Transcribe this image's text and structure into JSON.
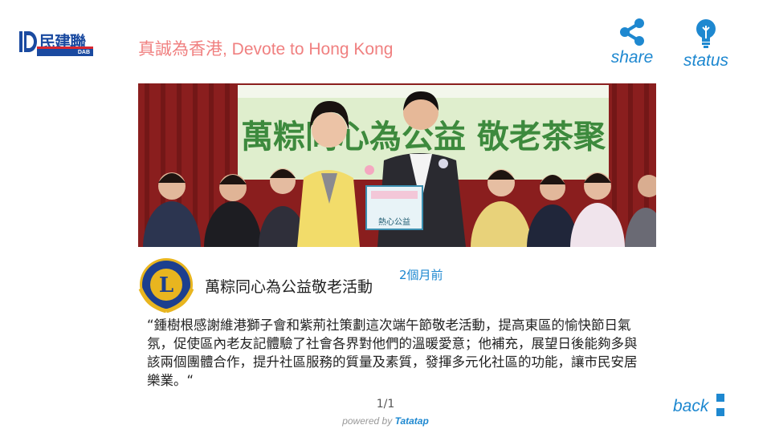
{
  "brand": {
    "logo_zh": "民建聯",
    "logo_en": "DAB",
    "tagline": "真誠為香港, Devote to Hong Kong"
  },
  "controls": {
    "share_label": "share",
    "status_label": "status",
    "back_label": "back",
    "icons": [
      "share-icon",
      "lightbulb-icon",
      "back-icon"
    ]
  },
  "photo": {
    "banner_text": "萬粽同心為公益 敬老茶聚",
    "certificate_text": "熱心公益"
  },
  "post": {
    "title": "萬粽同心為公益敬老活動",
    "time": "2個月前",
    "body": "“鍾樹根感謝維港獅子會和紫荊社策劃這次端午節敬老活動，提高東區的愉快節日氣氛，促使區內老友記體驗了社會各界對他們的溫暖愛意；他補充，展望日後能夠多與該兩個團體合作，提升社區服務的質量及素質，發揮多元化社區的功能，讓市民安居樂業。“"
  },
  "footer": {
    "pager": "1/1",
    "powered_prefix": "powered by ",
    "powered_brand": "Tatatap"
  },
  "colors": {
    "accent": "#1e88d0",
    "tagline": "#f08080",
    "logo_blue": "#1a4aa0",
    "logo_red": "#d8262f"
  }
}
